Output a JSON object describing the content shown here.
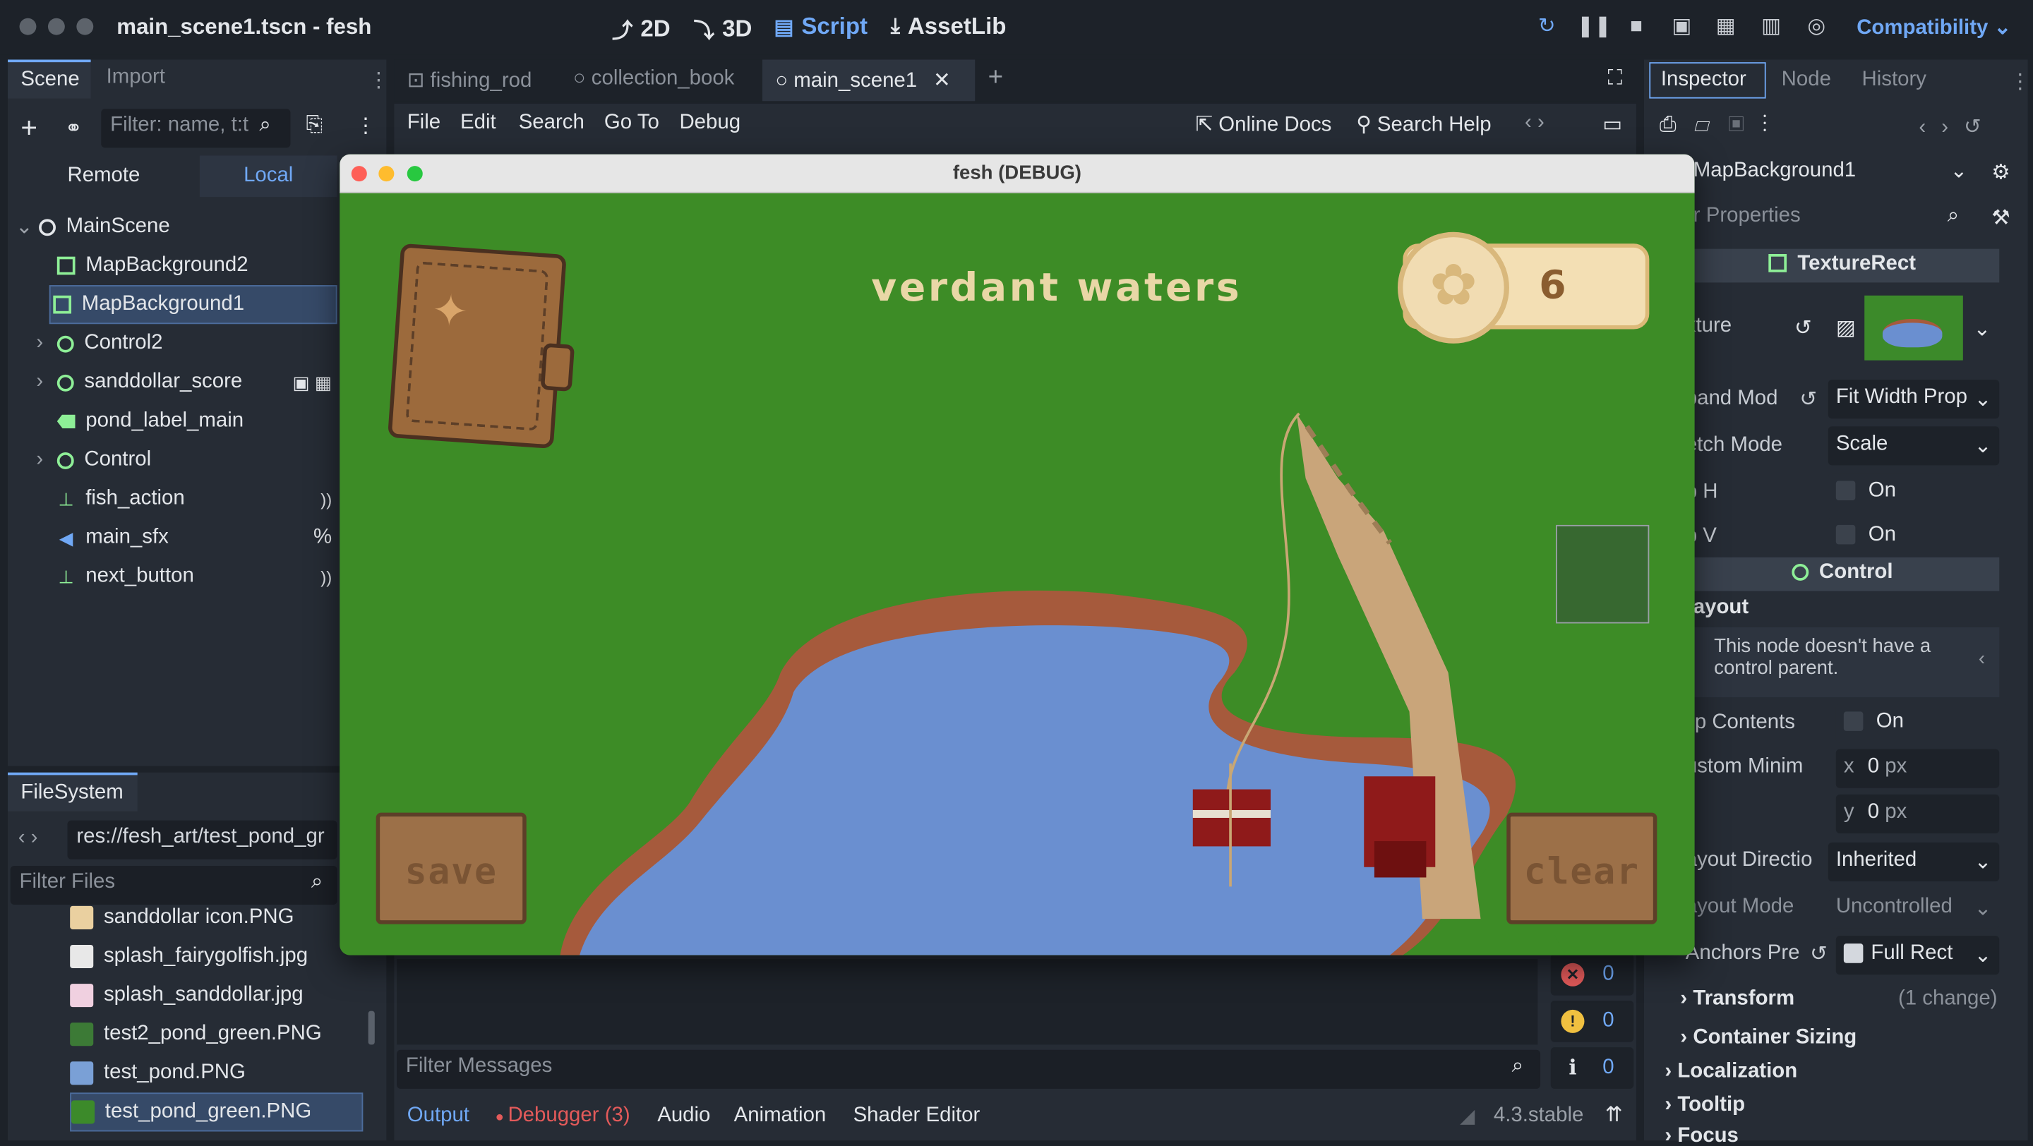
{
  "window": {
    "title": "main_scene1.tscn - fesh"
  },
  "modes": [
    {
      "label": "2D",
      "icon": "2d-icon"
    },
    {
      "label": "3D",
      "icon": "3d-icon"
    },
    {
      "label": "Script",
      "icon": "script-icon"
    },
    {
      "label": "AssetLib",
      "icon": "assetlib-icon"
    }
  ],
  "renderer": "Compatibility",
  "scene_dock": {
    "tabs": [
      "Scene",
      "Import"
    ],
    "filter_placeholder": "Filter: name, t:t",
    "remote_label": "Remote",
    "local_label": "Local",
    "tree": [
      {
        "name": "MainScene",
        "kind": "node-icon"
      },
      {
        "name": "MapBackground2",
        "kind": "texture-rect-icon"
      },
      {
        "name": "MapBackground1",
        "kind": "texture-rect-icon"
      },
      {
        "name": "Control2",
        "kind": "control-icon"
      },
      {
        "name": "sanddollar_score",
        "kind": "control-icon"
      },
      {
        "name": "pond_label_main",
        "kind": "label-icon"
      },
      {
        "name": "Control",
        "kind": "control-icon"
      },
      {
        "name": "fish_action",
        "kind": "button-icon"
      },
      {
        "name": "main_sfx",
        "kind": "audio-icon",
        "badge": "%"
      },
      {
        "name": "next_button",
        "kind": "button-icon"
      }
    ]
  },
  "filesystem": {
    "tab": "FileSystem",
    "path": "res://fesh_art/test_pond_gr",
    "filter_placeholder": "Filter Files",
    "files": [
      {
        "name": "sanddollar icon.PNG",
        "color": "#ead0a0"
      },
      {
        "name": "splash_fairygolfish.jpg",
        "color": "#e8e8e8"
      },
      {
        "name": "splash_sanddollar.jpg",
        "color": "#f0d0e0"
      },
      {
        "name": "test2_pond_green.PNG",
        "color": "#3c7a36"
      },
      {
        "name": "test_pond.PNG",
        "color": "#7aa0d6"
      },
      {
        "name": "test_pond_green.PNG",
        "color": "#3c8a2a"
      }
    ]
  },
  "editor_tabs": [
    "fishing_rod",
    "collection_book",
    "main_scene1"
  ],
  "script_menu": [
    "File",
    "Edit",
    "Search",
    "Go To",
    "Debug"
  ],
  "help": {
    "docs": "Online Docs",
    "search": "Search Help"
  },
  "game": {
    "title": "fesh (DEBUG)",
    "pond_label": "verdant waters",
    "score": "6",
    "save_label": "save",
    "clear_label": "clear"
  },
  "inspector": {
    "tabs": [
      "Inspector",
      "Node",
      "History"
    ],
    "node_name": "MapBackground1",
    "filter_placeholder": "r Properties",
    "class_header": "TextureRect",
    "rows": [
      {
        "label": "xture"
      },
      {
        "label": "pand Mod",
        "value": "Fit Width Prop"
      },
      {
        "label": "etch Mode",
        "value": "Scale"
      },
      {
        "label": "p H",
        "value": "On"
      },
      {
        "label": "p V",
        "value": "On"
      }
    ],
    "control_header": "Control",
    "layout_label": "ayout",
    "warning": "This node doesn't have a control parent.",
    "rows2": [
      {
        "label": "lip Contents",
        "value": "On"
      },
      {
        "label": "ustom Minim",
        "x": "0",
        "y": "0",
        "unit": "px"
      },
      {
        "label": "ayout Directio",
        "value": "Inherited"
      },
      {
        "label": "ayout Mode",
        "value": "Uncontrolled"
      },
      {
        "label": "Anchors Pre",
        "value": "Full Rect"
      }
    ],
    "sections": [
      "Transform",
      "Container Sizing",
      "Localization",
      "Tooltip",
      "Focus"
    ],
    "transform_changes": "(1 change)"
  },
  "output": {
    "filter_placeholder": "Filter Messages",
    "counts": {
      "errors": "0",
      "warnings": "0",
      "messages": "0"
    },
    "bottom_tabs": [
      "Output",
      "Debugger (3)",
      "Audio",
      "Animation",
      "Shader Editor"
    ],
    "version": "4.3.stable"
  },
  "colors": {
    "accent": "#70a8f5",
    "grass": "#3d8c26",
    "water": "#6a8fd0",
    "bank": "#a65a3c"
  }
}
